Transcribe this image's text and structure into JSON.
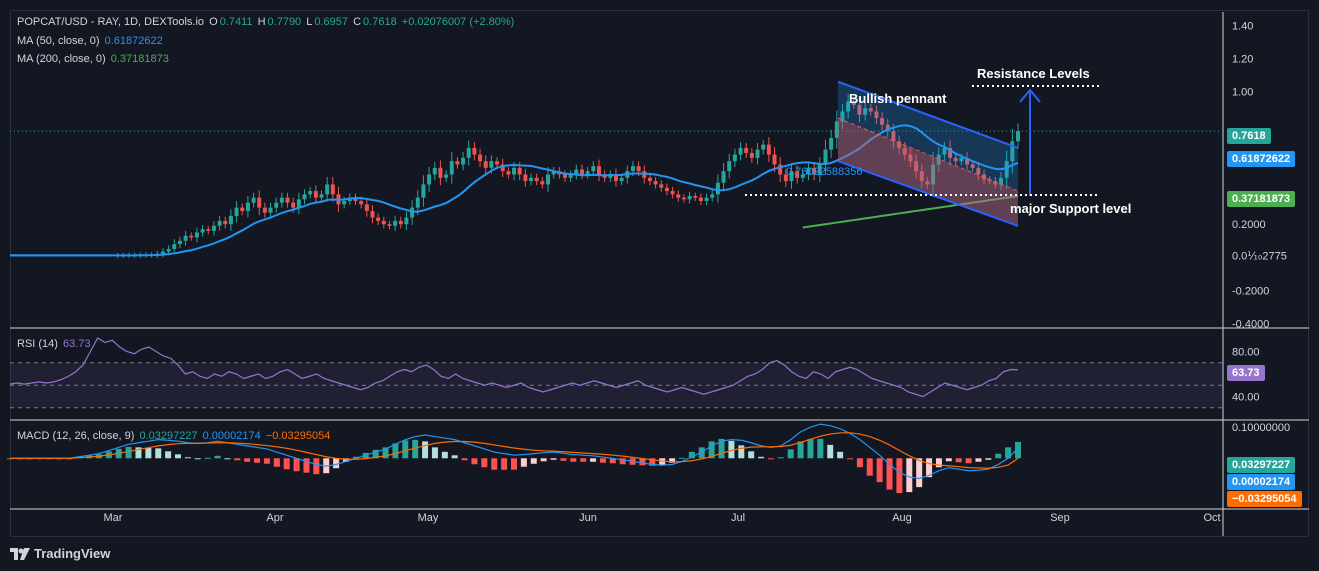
{
  "legend": {
    "symbol": "POPCAT/USD - RAY, 1D, DEXTools.io",
    "o_label": "O",
    "o_value": "0.7411",
    "h_label": "H",
    "h_value": "0.7790",
    "l_label": "L",
    "l_value": "0.6957",
    "c_label": "C",
    "c_value": "0.7618",
    "change": "+0.02076007 (+2.80%)",
    "ma50_label": "MA (50, close, 0)",
    "ma50_value": "0.61872622",
    "ma200_label": "MA (200, close, 0)",
    "ma200_value": "0.37181873"
  },
  "rsi": {
    "label": "RSI (14)",
    "value": "63.73"
  },
  "macd": {
    "label": "MACD (12, 26, close, 9)",
    "macd_value": "0.03297227",
    "signal_value": "0.00002174",
    "hist_value": "−0.03295054"
  },
  "tags": {
    "price": "0.7618",
    "ma50": "0.61872622",
    "ma200": "0.37181873",
    "rsi": "63.73",
    "macd": "0.03297227",
    "signal": "0.00002174",
    "hist": "−0.03295054"
  },
  "annotations": {
    "bullish_pennant": "Bullish pennant",
    "resistance": "Resistance  Levels",
    "support": "major Support level",
    "pennant_mid_value": "0.76022588356"
  },
  "footer": {
    "brand": "TradingView"
  },
  "colors": {
    "up": "#26a69a",
    "down": "#ef5350",
    "ma50": "#2196f3",
    "ma200": "#4caf50",
    "rsi": "#9575cd",
    "macd": "#2196f3",
    "signal": "#ff6d00",
    "bg": "#131722"
  },
  "chart_data": {
    "type": "candlestick",
    "title": "POPCAT/USD - RAY, 1D, DEXTools.io",
    "x_ticks": [
      "Mar",
      "Apr",
      "May",
      "Jun",
      "Jul",
      "Aug",
      "Sep",
      "Oct"
    ],
    "y_ticks": [
      "1.40",
      "1.20",
      "1.00",
      "0.2000",
      "0.0⅒2775",
      "-0.2000",
      "-0.4000"
    ],
    "ylim": [
      -0.42,
      1.48
    ],
    "close_series": [
      0.012,
      0.012,
      0.012,
      0.013,
      0.013,
      0.014,
      0.015,
      0.016,
      0.022,
      0.035,
      0.05,
      0.08,
      0.1,
      0.13,
      0.12,
      0.15,
      0.17,
      0.16,
      0.19,
      0.22,
      0.2,
      0.25,
      0.3,
      0.28,
      0.33,
      0.36,
      0.3,
      0.27,
      0.3,
      0.33,
      0.36,
      0.33,
      0.3,
      0.35,
      0.38,
      0.4,
      0.36,
      0.38,
      0.44,
      0.38,
      0.32,
      0.34,
      0.36,
      0.34,
      0.32,
      0.28,
      0.24,
      0.22,
      0.2,
      0.19,
      0.22,
      0.2,
      0.24,
      0.3,
      0.36,
      0.44,
      0.5,
      0.54,
      0.48,
      0.5,
      0.58,
      0.56,
      0.6,
      0.66,
      0.62,
      0.58,
      0.54,
      0.58,
      0.56,
      0.52,
      0.5,
      0.54,
      0.5,
      0.46,
      0.48,
      0.46,
      0.44,
      0.5,
      0.52,
      0.5,
      0.48,
      0.5,
      0.53,
      0.5,
      0.52,
      0.55,
      0.5,
      0.48,
      0.5,
      0.46,
      0.48,
      0.52,
      0.55,
      0.52,
      0.48,
      0.46,
      0.44,
      0.42,
      0.4,
      0.38,
      0.36,
      0.35,
      0.37,
      0.36,
      0.34,
      0.36,
      0.38,
      0.45,
      0.52,
      0.58,
      0.62,
      0.66,
      0.63,
      0.6,
      0.65,
      0.68,
      0.62,
      0.56,
      0.5,
      0.46,
      0.52,
      0.48,
      0.5,
      0.54,
      0.5,
      0.56,
      0.65,
      0.72,
      0.82,
      0.88,
      0.94,
      0.92,
      0.86,
      0.9,
      0.88,
      0.84,
      0.8,
      0.76,
      0.7,
      0.66,
      0.62,
      0.58,
      0.52,
      0.46,
      0.44,
      0.56,
      0.62,
      0.66,
      0.6,
      0.58,
      0.6,
      0.56,
      0.54,
      0.5,
      0.47,
      0.46,
      0.44,
      0.48,
      0.58,
      0.7,
      0.7618
    ],
    "ma50_value": 0.61872622,
    "ma200_value": 0.37181873,
    "rsi_ylim": [
      20,
      100
    ],
    "rsi_ticks": [
      "80.00",
      "40.00"
    ],
    "rsi_series": [
      51,
      52,
      51,
      52,
      53,
      52,
      53,
      55,
      58,
      62,
      68,
      80,
      92,
      88,
      90,
      84,
      80,
      78,
      82,
      84,
      80,
      76,
      74,
      68,
      60,
      62,
      58,
      56,
      60,
      58,
      62,
      60,
      56,
      58,
      60,
      56,
      58,
      62,
      64,
      60,
      56,
      58,
      60,
      56,
      54,
      52,
      50,
      48,
      46,
      48,
      52,
      54,
      58,
      62,
      64,
      62,
      66,
      68,
      64,
      58,
      56,
      60,
      56,
      54,
      52,
      50,
      52,
      50,
      48,
      50,
      52,
      48,
      46,
      44,
      46,
      48,
      50,
      52,
      50,
      52,
      54,
      52,
      50,
      48,
      50,
      52,
      54,
      50,
      48,
      46,
      44,
      46,
      48,
      46,
      44,
      42,
      44,
      46,
      48,
      50,
      54,
      58,
      60,
      64,
      70,
      72,
      68,
      62,
      58,
      56,
      62,
      60,
      56,
      62,
      64,
      66,
      64,
      60,
      56,
      54,
      52,
      50,
      48,
      44,
      42,
      40,
      44,
      48,
      52,
      50,
      48,
      46,
      48,
      50,
      54,
      56,
      62,
      64,
      63.73
    ],
    "macd_ylim": [
      -0.16,
      0.12
    ],
    "macd_ticks": [
      "0.10000000"
    ],
    "macd_series": [
      0,
      0,
      0,
      0,
      0,
      0,
      0,
      0.005,
      0.01,
      0.015,
      0.025,
      0.035,
      0.045,
      0.05,
      0.055,
      0.06,
      0.058,
      0.055,
      0.05,
      0.048,
      0.05,
      0.055,
      0.05,
      0.045,
      0.04,
      0.035,
      0.03,
      0.02,
      0.01,
      0,
      -0.01,
      -0.02,
      -0.025,
      -0.02,
      -0.01,
      0,
      0.01,
      0.02,
      0.03,
      0.045,
      0.06,
      0.07,
      0.075,
      0.07,
      0.065,
      0.06,
      0.05,
      0.04,
      0.03,
      0.02,
      0.015,
      0.01,
      0.012,
      0.015,
      0.018,
      0.02,
      0.016,
      0.012,
      0.01,
      0.008,
      0.004,
      0,
      -0.005,
      -0.01,
      -0.015,
      -0.02,
      -0.022,
      -0.02,
      -0.01,
      0.005,
      0.02,
      0.04,
      0.055,
      0.06,
      0.058,
      0.05,
      0.04,
      0.035,
      0.04,
      0.06,
      0.085,
      0.1,
      0.11,
      0.105,
      0.095,
      0.08,
      0.06,
      0.035,
      0.01,
      -0.02,
      -0.045,
      -0.06,
      -0.065,
      -0.055,
      -0.04,
      -0.03,
      -0.035,
      -0.04,
      -0.038,
      -0.035,
      -0.02,
      0.0,
      0.0329722
    ],
    "signal_series": [
      0,
      0,
      0,
      0,
      0,
      0,
      0,
      0.002,
      0.004,
      0.007,
      0.011,
      0.016,
      0.022,
      0.028,
      0.034,
      0.04,
      0.044,
      0.047,
      0.048,
      0.048,
      0.049,
      0.05,
      0.05,
      0.049,
      0.047,
      0.044,
      0.041,
      0.037,
      0.032,
      0.026,
      0.019,
      0.012,
      0.005,
      0.0,
      -0.003,
      -0.003,
      -0.001,
      0.003,
      0.008,
      0.015,
      0.024,
      0.033,
      0.041,
      0.048,
      0.052,
      0.054,
      0.054,
      0.052,
      0.048,
      0.043,
      0.038,
      0.033,
      0.029,
      0.026,
      0.024,
      0.023,
      0.021,
      0.019,
      0.017,
      0.015,
      0.013,
      0.01,
      0.007,
      0.003,
      -0.001,
      -0.005,
      -0.009,
      -0.011,
      -0.011,
      -0.008,
      -0.002,
      0.006,
      0.016,
      0.025,
      0.032,
      0.036,
      0.037,
      0.037,
      0.038,
      0.042,
      0.051,
      0.061,
      0.071,
      0.078,
      0.082,
      0.082,
      0.078,
      0.07,
      0.058,
      0.043,
      0.025,
      0.008,
      -0.007,
      -0.017,
      -0.022,
      -0.024,
      -0.027,
      -0.03,
      -0.031,
      -0.032,
      -0.029,
      -0.022,
      2.174e-05
    ]
  }
}
